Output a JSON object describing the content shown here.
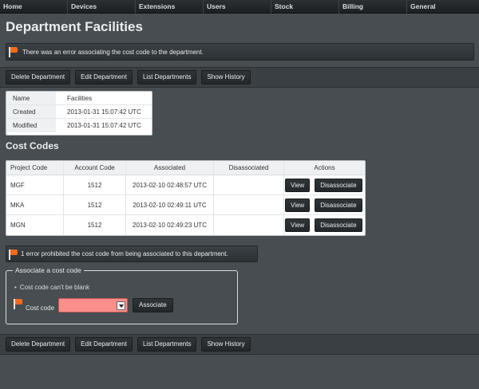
{
  "nav": {
    "items": [
      {
        "label": "Home"
      },
      {
        "label": "Devices"
      },
      {
        "label": "Extensions"
      },
      {
        "label": "Users"
      },
      {
        "label": "Stock"
      },
      {
        "label": "Billing"
      },
      {
        "label": "General"
      }
    ]
  },
  "page": {
    "title": "Department Facilities",
    "error_message": "There was an error associating the cost code to the department."
  },
  "toolbar": {
    "delete_label": "Delete Department",
    "edit_label": "Edit Department",
    "list_label": "List Departments",
    "history_label": "Show History"
  },
  "details": {
    "rows": [
      {
        "label": "Name",
        "value": "Facilities"
      },
      {
        "label": "Created",
        "value": "2013-01-31 15:07:42 UTC"
      },
      {
        "label": "Modified",
        "value": "2013-01-31 15:07:42 UTC"
      }
    ]
  },
  "cost_codes": {
    "section_title": "Cost Codes",
    "headers": [
      "Project Code",
      "Account Code",
      "Associated",
      "Disassociated",
      "Actions"
    ],
    "rows": [
      {
        "project_code": "MGF",
        "account_code": "1512",
        "associated": "2013-02-10 02:48:57 UTC",
        "disassociated": "",
        "view_label": "View",
        "disassociate_label": "Disassociate"
      },
      {
        "project_code": "MKA",
        "account_code": "1512",
        "associated": "2013-02-10 02:49:11 UTC",
        "disassociated": "",
        "view_label": "View",
        "disassociate_label": "Disassociate"
      },
      {
        "project_code": "MGN",
        "account_code": "1512",
        "associated": "2013-02-10 02:49:23 UTC",
        "disassociated": "",
        "view_label": "View",
        "disassociate_label": "Disassociate"
      }
    ]
  },
  "form": {
    "error_summary": "1 error prohibited the cost code from being associated to this department.",
    "legend": "Associate a cost code",
    "field_error": "Cost code can't be blank",
    "field_label": "Cost code",
    "selected_value": "",
    "submit_label": "Associate",
    "error_color": "#fb8f8c"
  },
  "icons": {
    "flag": "flag-icon",
    "dropdown": "chevron-down-icon"
  }
}
